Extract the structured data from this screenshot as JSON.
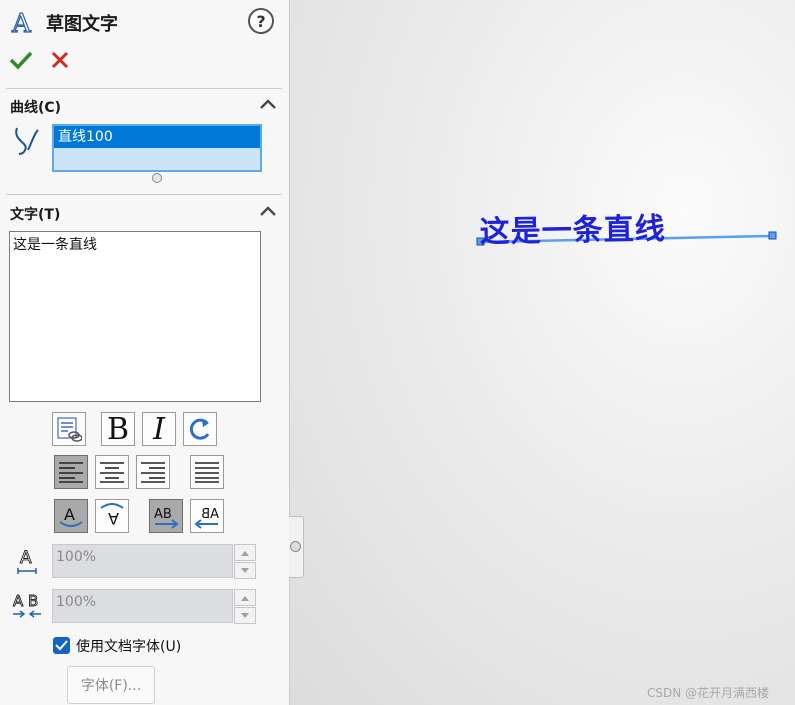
{
  "header": {
    "title": "草图文字",
    "help_label": "?"
  },
  "actions": {
    "ok_icon": "checkmark-icon",
    "cancel_icon": "close-icon"
  },
  "curve_section": {
    "title": "曲线(C)",
    "items": [
      "直线100"
    ]
  },
  "text_section": {
    "title": "文字(T)",
    "content": "这是一条直线",
    "bold_label": "B",
    "italic_label": "I"
  },
  "width_factor": {
    "value": "100%"
  },
  "spacing": {
    "value": "100%"
  },
  "use_doc_font": {
    "label": "使用文档字体(U)",
    "checked": true
  },
  "font_button": {
    "label": "字体(F)..."
  },
  "canvas": {
    "sketch_text": "这是一条直线",
    "text_color": "#1e22d8",
    "line_color": "#5aa0f0"
  },
  "watermark": "CSDN @花开月满西楼",
  "colors": {
    "accent": "#0078d7",
    "ok": "#2e8b2e",
    "cancel": "#d0281e"
  }
}
